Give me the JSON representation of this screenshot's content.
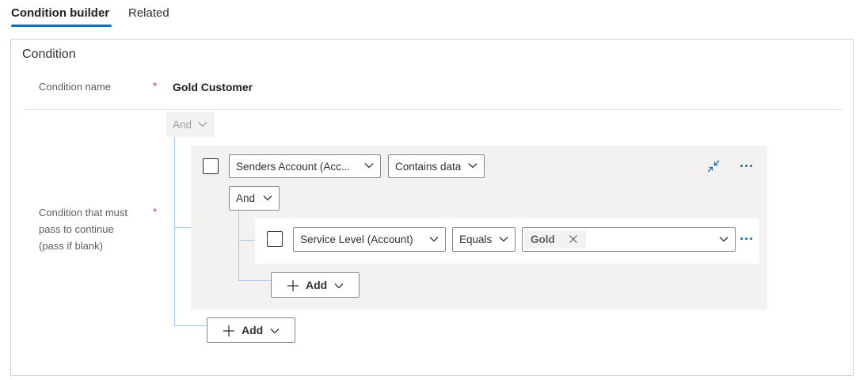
{
  "tabs": [
    {
      "label": "Condition builder",
      "active": true
    },
    {
      "label": "Related",
      "active": false
    }
  ],
  "section": {
    "title": "Condition"
  },
  "fields": {
    "condition_name": {
      "label": "Condition name",
      "required_mark": "*",
      "value": "Gold Customer"
    },
    "condition_rule": {
      "label_lines": [
        "Condition that must",
        "pass to continue",
        "(pass if blank)"
      ],
      "required_mark": "*"
    }
  },
  "builder": {
    "root_operator": "And",
    "group": {
      "field": "Senders Account (Acc...",
      "operator": "Contains data",
      "sub_operator": "And",
      "row": {
        "field": "Service Level (Account)",
        "operator": "Equals",
        "value_tag": "Gold"
      },
      "add_label": "Add"
    },
    "add_label": "Add"
  },
  "icons": {
    "collapse": "collapse-icon",
    "more": "more-options-icon",
    "chevron": "chevron-down-icon",
    "remove": "close-icon",
    "add": "plus-icon"
  },
  "colors": {
    "accent": "#0f6cbd",
    "required": "#d13438",
    "connector": "#a6c8ee"
  }
}
